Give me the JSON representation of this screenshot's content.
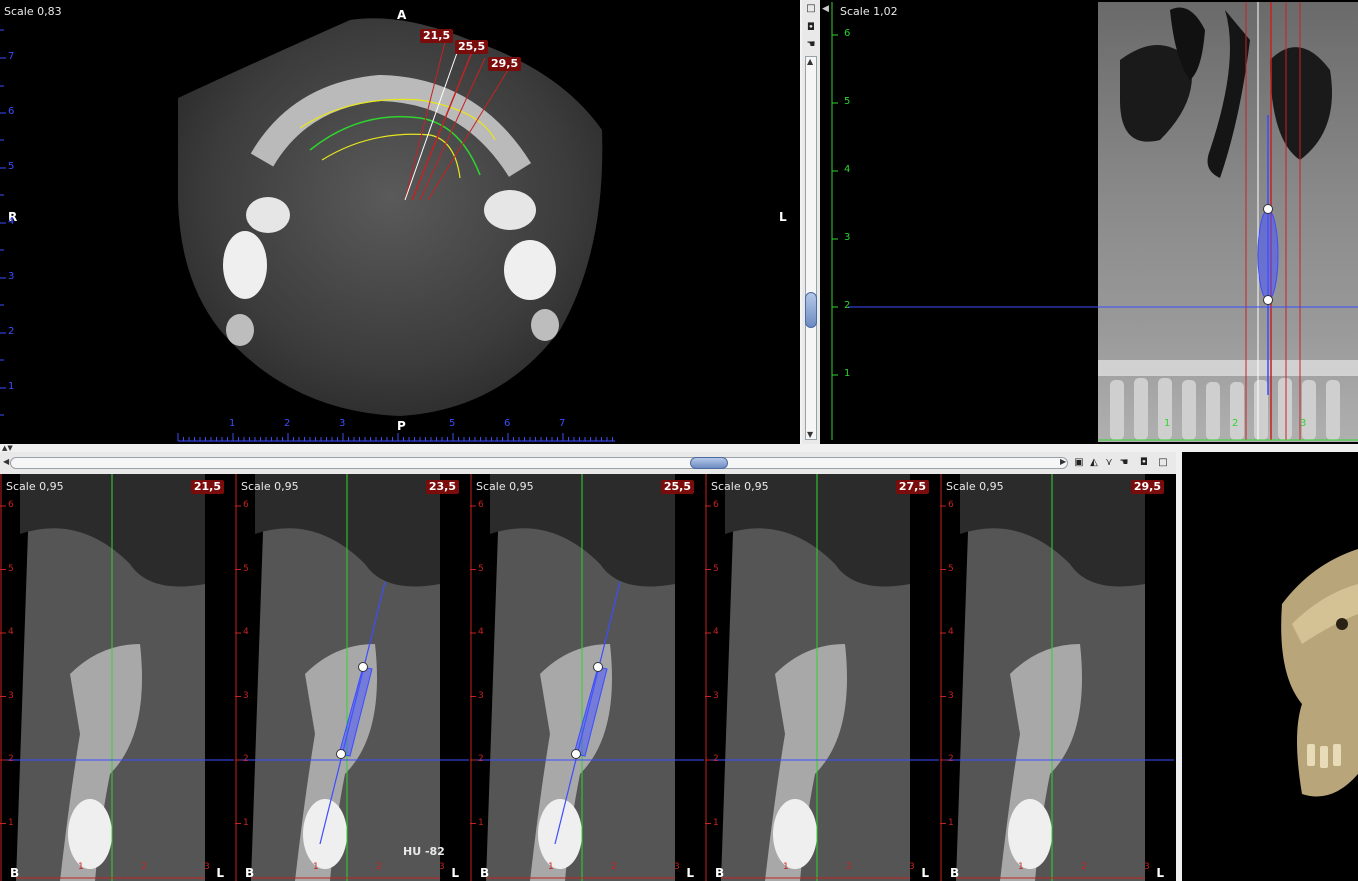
{
  "axial": {
    "scale": "Scale 0,83",
    "orient_top": "A",
    "orient_bottom": "P",
    "orient_left": "R",
    "orient_right": "L",
    "markers": [
      "21,5",
      "25,5",
      "29,5"
    ],
    "ruler_left": [
      "7",
      "6",
      "5",
      "4",
      "3",
      "2",
      "1"
    ],
    "ruler_bottom": [
      "1",
      "2",
      "3",
      "4",
      "5",
      "6",
      "7"
    ]
  },
  "panoramic": {
    "scale": "Scale 1,02",
    "ruler_left": [
      "6",
      "5",
      "4",
      "3",
      "2",
      "1"
    ],
    "ruler_bottom": [
      "1",
      "2",
      "3"
    ]
  },
  "cross_sections": [
    {
      "scale": "Scale 0,95",
      "slice": "21,5",
      "left": "B",
      "right": "L",
      "hu": ""
    },
    {
      "scale": "Scale 0,95",
      "slice": "23,5",
      "left": "B",
      "right": "L",
      "hu": "HU -82"
    },
    {
      "scale": "Scale 0,95",
      "slice": "25,5",
      "left": "B",
      "right": "L",
      "hu": ""
    },
    {
      "scale": "Scale 0,95",
      "slice": "27,5",
      "left": "B",
      "right": "L",
      "hu": ""
    },
    {
      "scale": "Scale 0,95",
      "slice": "29,5",
      "left": "B",
      "right": "L",
      "hu": ""
    }
  ],
  "section_ruler": [
    "6",
    "5",
    "4",
    "3",
    "2",
    "1"
  ],
  "section_ruler_bottom": [
    "1",
    "2",
    "3"
  ],
  "icons": {
    "vertical_toolbar": [
      "window-icon",
      "camera-icon",
      "hand-icon"
    ],
    "horizontal_toolbar": [
      "lock-icon",
      "mirror-icon",
      "flip-icon",
      "hand-icon",
      "camera-icon",
      "window-icon"
    ]
  },
  "colors": {
    "accent_blue": "#3b4dff",
    "guide_green": "#2fd42f",
    "marker_red": "#c52222",
    "badge_red": "#7a0c0c",
    "canal_yellow": "#e6e61e"
  }
}
